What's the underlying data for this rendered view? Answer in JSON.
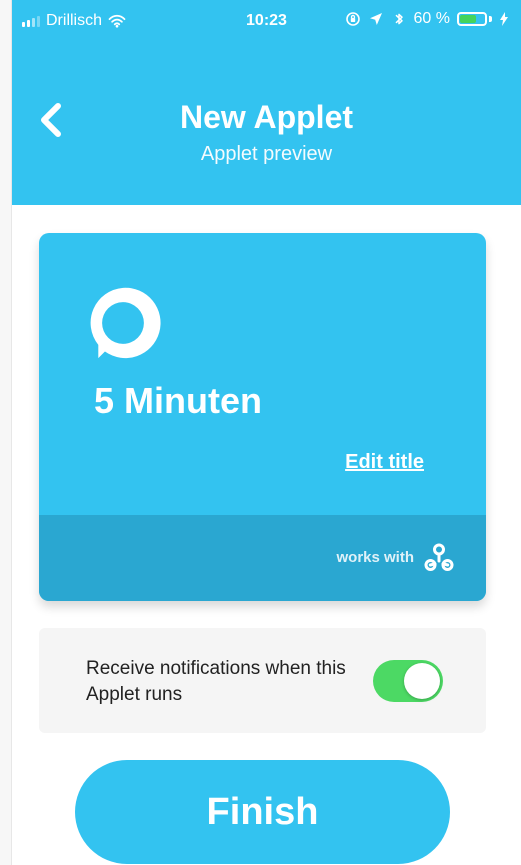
{
  "status_bar": {
    "carrier": "Drillisch",
    "time": "10:23",
    "battery_percent": "60 %",
    "battery_level": 0.6
  },
  "header": {
    "title": "New Applet",
    "subtitle": "Applet preview"
  },
  "card": {
    "title": "5 Minuten",
    "edit_label": "Edit title",
    "works_with": "works with"
  },
  "notifications": {
    "label": "Receive notifications when this Applet runs",
    "enabled": true
  },
  "actions": {
    "finish": "Finish"
  },
  "colors": {
    "primary": "#33c3f0",
    "footer": "#2aa7d1",
    "toggle_on": "#4cd964",
    "notification_bg": "#f5f5f5"
  },
  "icons": {
    "back": "back-icon",
    "service": "alexa-icon",
    "works_with": "webhook-icon"
  }
}
